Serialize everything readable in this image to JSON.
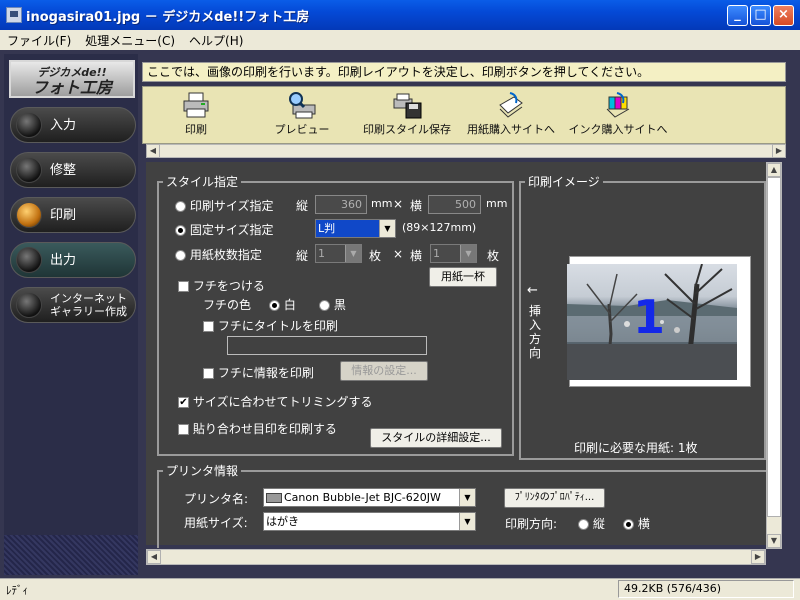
{
  "window": {
    "title": "inogasira01.jpg － デジカメde!!フォト工房"
  },
  "menu": [
    "ファイル(F)",
    "処理メニュー(C)",
    "ヘルプ(H)"
  ],
  "sidebar": {
    "logo_line1": "デジカメde!!",
    "logo_line2": "フォト工房",
    "items": [
      {
        "label": "入力"
      },
      {
        "label": "修整"
      },
      {
        "label": "印刷",
        "active": true
      },
      {
        "label": "出力"
      },
      {
        "label_line1": "インターネット",
        "label_line2": "ギャラリー作成"
      }
    ]
  },
  "info": "ここでは、画像の印刷を行います。印刷レイアウトを決定し、印刷ボタンを押してください。",
  "toolbar": [
    "印刷",
    "プレビュー",
    "印刷スタイル保存",
    "用紙購入サイトへ",
    "インク購入サイトへ"
  ],
  "style": {
    "title": "スタイル指定",
    "opt_size": "印刷サイズ指定",
    "opt_fixed": "固定サイズ指定",
    "opt_sheets": "用紙枚数指定",
    "tate": "縦",
    "yoko": "横",
    "mm": "mm",
    "times": "×",
    "mai": "枚",
    "width_val": "360",
    "height_val": "500",
    "fixed_val": "L判",
    "fixed_dim": "(89×127mm)",
    "sheets_v": "1",
    "sheets_h": "1",
    "paper_full": "用紙一杯",
    "border": "フチをつける",
    "border_color": "フチの色",
    "white": "白",
    "black": "黒",
    "title_print": "フチにタイトルを印刷",
    "info_print": "フチに情報を印刷",
    "info_settings": "情報の設定...",
    "trim": "サイズに合わせてトリミングする",
    "register": "貼り合わせ目印を印刷する",
    "detail": "スタイルの詳細設定..."
  },
  "preview": {
    "title": "印刷イメージ",
    "arrow": "←",
    "direction_chars": [
      "挿",
      "入",
      "方",
      "向"
    ],
    "page_number": "1",
    "need": "印刷に必要な用紙: 1枚"
  },
  "printer": {
    "title": "プリンタ情報",
    "name_label": "プリンタ名:",
    "name_val": "Canon Bubble-Jet BJC-620JW",
    "props": "ﾌﾟﾘﾝﾀのﾌﾟﾛﾊﾟﾃｨ...",
    "paper_label": "用紙サイズ:",
    "paper_val": "はがき",
    "orient_label": "印刷方向:",
    "portrait": "縦",
    "landscape": "横"
  },
  "status": {
    "left": "ﾚﾃﾞｨ",
    "right": "49.2KB (576/436)"
  }
}
